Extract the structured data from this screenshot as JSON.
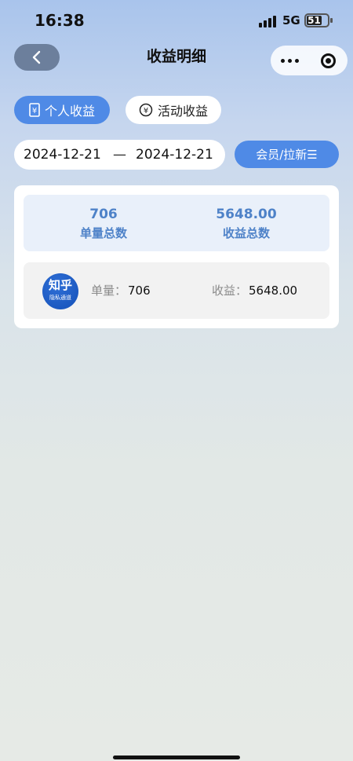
{
  "status_bar": {
    "time": "16:38",
    "network": "5G",
    "battery": "51"
  },
  "header": {
    "title": "收益明细",
    "back_icon": "chevron-left-icon",
    "more_icon": "more-dots-icon",
    "close_icon": "target-circle-icon"
  },
  "tabs": [
    {
      "label": "个人收益",
      "icon": "receipt-icon",
      "active": true
    },
    {
      "label": "活动收益",
      "icon": "yen-coin-icon",
      "active": false
    }
  ],
  "filters": {
    "start_date": "2024-12-21",
    "separator": "—",
    "end_date": "2024-12-21",
    "category_button": "会员/拉新☰"
  },
  "summary": {
    "quantity_value": "706",
    "quantity_label": "单量总数",
    "income_value": "5648.00",
    "income_label": "收益总数"
  },
  "records": [
    {
      "logo_text": "知乎",
      "logo_subtext": "隐私通道",
      "quantity_label": "单量：",
      "quantity_value": "706",
      "income_label": "收益：",
      "income_value": "5648.00"
    }
  ],
  "colors": {
    "accent": "#4f8ae6",
    "summary_text": "#4e82c8",
    "summary_bg": "#e9f0fa",
    "back_button": "#6c7f9c"
  }
}
